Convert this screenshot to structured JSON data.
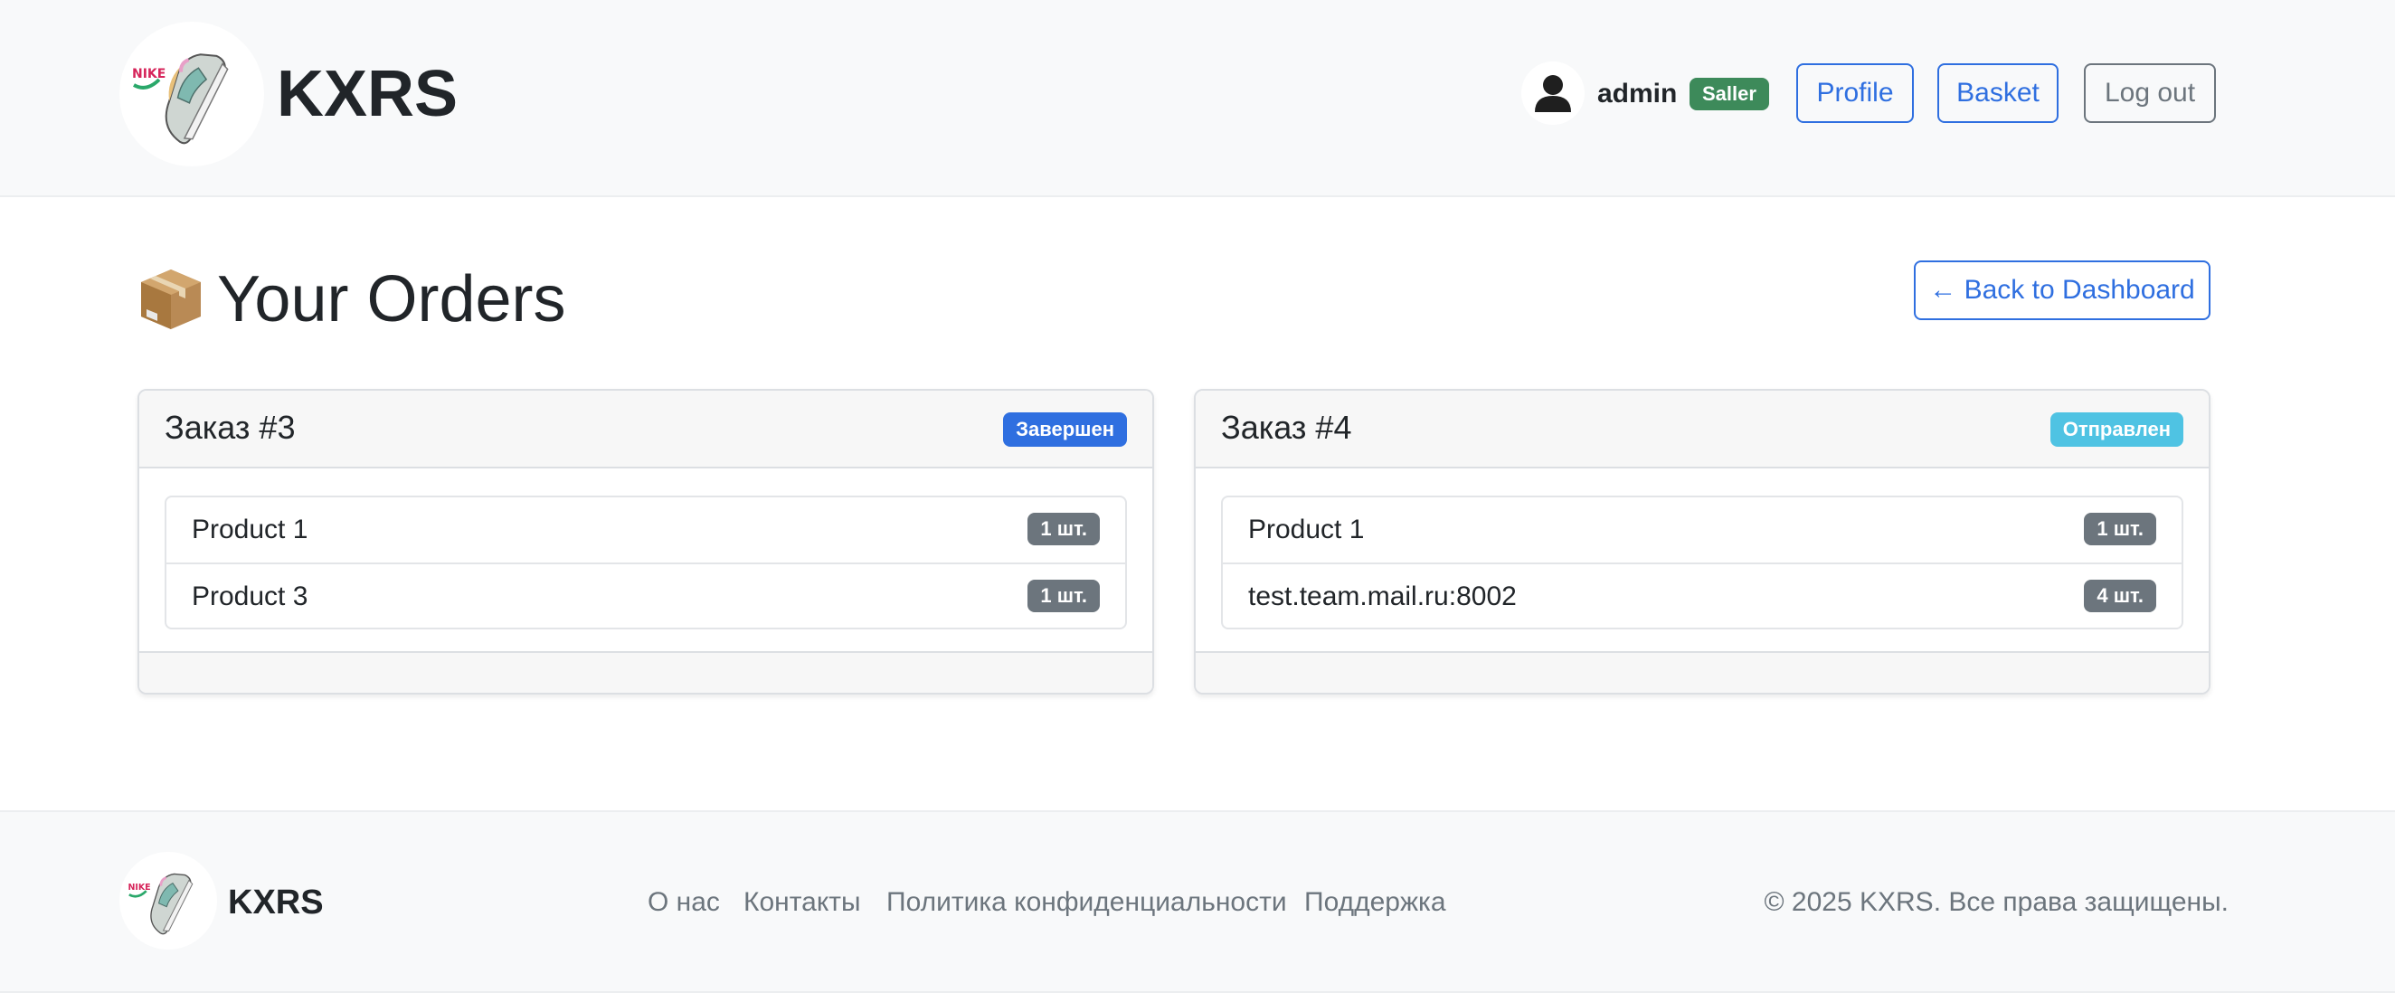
{
  "header": {
    "brand": "KXRS",
    "logo_icon": "sneaker-logo-icon",
    "user": {
      "avatar_icon": "user-avatar-icon",
      "name": "admin",
      "role": "Saller"
    },
    "buttons": {
      "profile": "Profile",
      "basket": "Basket",
      "logout": "Log out"
    }
  },
  "main": {
    "title_icon": "package-icon",
    "title": "Your Orders",
    "back_button": "← Back to Dashboard",
    "orders": [
      {
        "title": "Заказ #3",
        "status": "Завершен",
        "status_color": "#2f6fe0",
        "items": [
          {
            "name": "Product 1",
            "qty": "1 шт."
          },
          {
            "name": "Product 3",
            "qty": "1 шт."
          }
        ]
      },
      {
        "title": "Заказ #4",
        "status": "Отправлен",
        "status_color": "#4fc3e3",
        "items": [
          {
            "name": "Product 1",
            "qty": "1 шт."
          },
          {
            "name": "test.team.mail.ru:8002",
            "qty": "4 шт."
          }
        ]
      }
    ]
  },
  "footer": {
    "brand": "KXRS",
    "links": [
      "О нас",
      "Контакты",
      "Политика конфиденциальности",
      "Поддержка"
    ],
    "copyright": "© 2025 KXRS. Все права защищены."
  },
  "colors": {
    "primary": "#2f6fe0",
    "success": "#3d8a5a",
    "secondary": "#6c757d",
    "header_bg": "#f8f9fa"
  }
}
